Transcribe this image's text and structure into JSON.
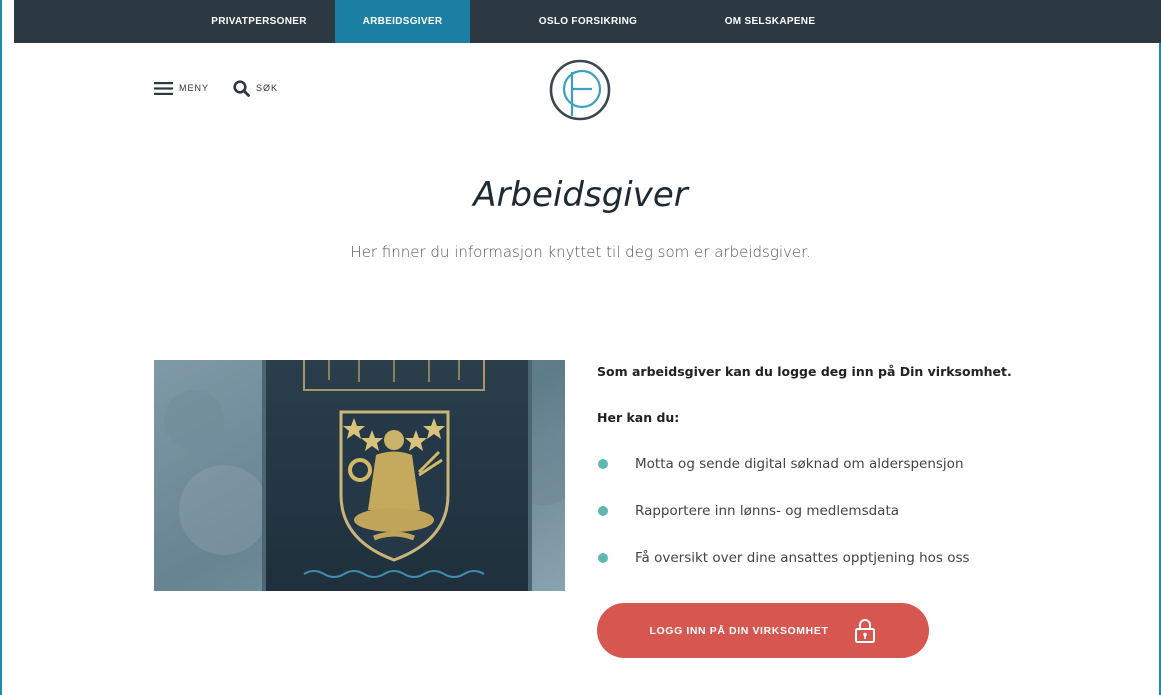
{
  "top_nav": {
    "items": [
      {
        "label": "PRIVATPERSONER",
        "active": false
      },
      {
        "label": "ARBEIDSGIVER",
        "active": true
      },
      {
        "label": "OSLO FORSIKRING",
        "active": false
      },
      {
        "label": "OM SELSKAPENE",
        "active": false
      }
    ]
  },
  "header": {
    "menu_label": "MENY",
    "search_label": "SØK",
    "menu_icon": "hamburger-icon",
    "search_icon": "search-icon"
  },
  "main": {
    "title": "Arbeidsgiver",
    "intro": "Her finner du informasjon knyttet til deg som er arbeidsgiver.",
    "lead": "Som arbeidsgiver kan du logge deg inn på Din virksomhet.",
    "list_heading": "Her kan du:",
    "benefits": [
      "Motta og sende digital søknad om alderspensjon",
      "Rapportere inn lønns- og medlemsdata",
      "Få oversikt over dine ansattes opptjening hos oss"
    ],
    "login_button_label": "LOGG INN PÅ DIN VIRKSOMHET",
    "login_icon": "lock-icon"
  },
  "colors": {
    "nav_bg": "#2c3942",
    "nav_active": "#1b7fa3",
    "accent_button": "#d65750",
    "bullet": "#5fb8b0"
  }
}
